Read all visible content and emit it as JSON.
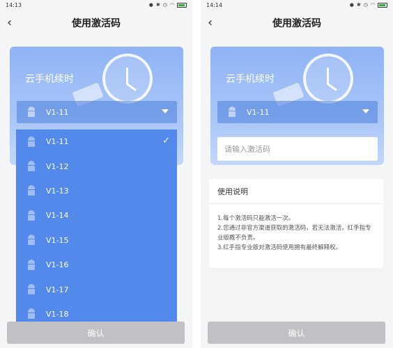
{
  "screens": [
    {
      "time": "14:13",
      "title": "使用激活码",
      "card_title": "云手机续时",
      "selected": "V1-11",
      "dropdown": [
        "V1-11",
        "V1-12",
        "V1-13",
        "V1-14",
        "V1-15",
        "V1-16",
        "V1-17",
        "V1-18"
      ],
      "confirm": "确认"
    },
    {
      "time": "14:14",
      "title": "使用激活码",
      "card_title": "云手机续时",
      "selected": "V1-11",
      "input_placeholder": "请输入激活码",
      "instructions_title": "使用说明",
      "instructions": [
        "1.每个激活码只能激活一次。",
        "2.您通过非官方渠道获取的激活码，若无法激活，红手指专业版概不负责。",
        "3.红手指专业版对激活码使用拥有最终解释权。"
      ],
      "confirm": "确认"
    }
  ],
  "icons": {
    "back": "chevron-left-icon",
    "dropdown": "caret-down-icon",
    "check": "check-icon",
    "device": "android-icon"
  },
  "colors": {
    "card": "#8fb3f5",
    "dropdown": "#5289ea",
    "button": "#bfc1c5"
  }
}
